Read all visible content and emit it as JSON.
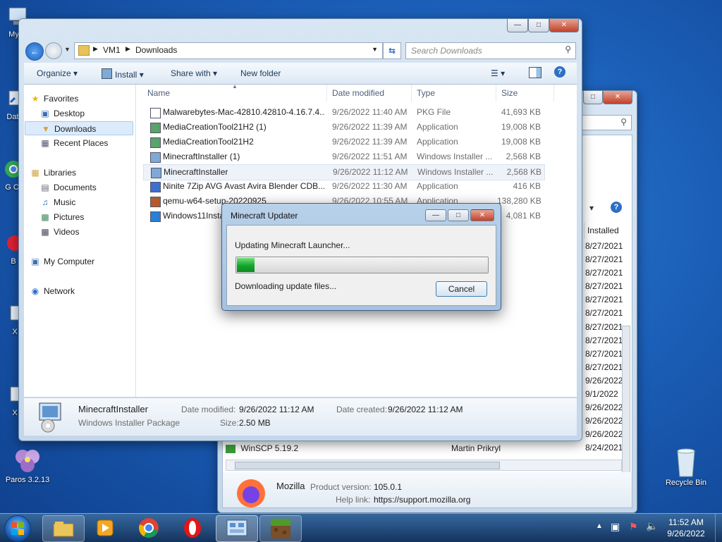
{
  "desktop": {
    "icons": [
      {
        "label": "My C",
        "icon": "computer-icon"
      },
      {
        "label": "Data",
        "icon": "shortcut-icon"
      },
      {
        "label": "G C",
        "icon": "chrome-icon"
      },
      {
        "label": "B",
        "icon": "app-icon"
      },
      {
        "label": "X",
        "icon": "app-icon"
      },
      {
        "label": "X",
        "icon": "app-icon"
      },
      {
        "label": "Paros 3.2.13",
        "icon": "flower-icon"
      },
      {
        "label": "Recycle Bin",
        "icon": "recycle-bin-icon"
      }
    ]
  },
  "explorer": {
    "breadcrumb": [
      "VM1",
      "Downloads"
    ],
    "search_placeholder": "Search Downloads",
    "toolbar": {
      "organize": "Organize",
      "install": "Install",
      "share_with": "Share with",
      "new_folder": "New folder"
    },
    "nav": {
      "favorites": "Favorites",
      "desktop": "Desktop",
      "downloads": "Downloads",
      "recent_places": "Recent Places",
      "libraries": "Libraries",
      "documents": "Documents",
      "music": "Music",
      "pictures": "Pictures",
      "videos": "Videos",
      "my_computer": "My Computer",
      "network": "Network"
    },
    "columns": {
      "name": "Name",
      "date_modified": "Date modified",
      "type": "Type",
      "size": "Size"
    },
    "files": [
      {
        "name": "Malwarebytes-Mac-42810.42810-4.16.7.4...",
        "date": "9/26/2022 11:40 AM",
        "type": "PKG File",
        "size": "41,693 KB"
      },
      {
        "name": "MediaCreationTool21H2 (1)",
        "date": "9/26/2022 11:39 AM",
        "type": "Application",
        "size": "19,008 KB"
      },
      {
        "name": "MediaCreationTool21H2",
        "date": "9/26/2022 11:39 AM",
        "type": "Application",
        "size": "19,008 KB"
      },
      {
        "name": "MinecraftInstaller (1)",
        "date": "9/26/2022 11:51 AM",
        "type": "Windows Installer ...",
        "size": "2,568 KB"
      },
      {
        "name": "MinecraftInstaller",
        "date": "9/26/2022 11:12 AM",
        "type": "Windows Installer ...",
        "size": "2,568 KB"
      },
      {
        "name": "Ninite 7Zip AVG Avast Avira Blender CDB...",
        "date": "9/26/2022 11:30 AM",
        "type": "Application",
        "size": "416 KB"
      },
      {
        "name": "qemu-w64-setup-20220925",
        "date": "9/26/2022 10:55 AM",
        "type": "Application",
        "size": "138,280 KB"
      },
      {
        "name": "Windows11Installer",
        "date": "",
        "type": "",
        "size": "4,081 KB"
      }
    ],
    "details": {
      "name": "MinecraftInstaller",
      "type": "Windows Installer Package",
      "date_modified_label": "Date modified:",
      "date_modified": "9/26/2022 11:12 AM",
      "date_created_label": "Date created:",
      "date_created": "9/26/2022 11:12 AM",
      "size_label": "Size:",
      "size": "2.50 MB"
    }
  },
  "programs_window": {
    "installed_header": "Installed",
    "dates": [
      "8/27/2021",
      "8/27/2021",
      "8/27/2021",
      "8/27/2021",
      "8/27/2021",
      "8/27/2021",
      "8/27/2021",
      "8/27/2021",
      "8/27/2021",
      "8/27/2021",
      "9/26/2022",
      "9/1/2022",
      "9/26/2022",
      "9/26/2022",
      "9/26/2022",
      "8/24/2021"
    ],
    "last_row_name": "WinSCP 5.19.2",
    "last_row_publisher": "Martin Prikryl",
    "selected_name": "Mozilla",
    "product_version_label": "Product version:",
    "product_version": "105.0.1",
    "help_link_label": "Help link:",
    "help_link": "https://support.mozilla.org"
  },
  "updater": {
    "title": "Minecraft Updater",
    "message": "Updating Minecraft Launcher...",
    "progress": 0.07,
    "status": "Downloading update files...",
    "cancel": "Cancel"
  },
  "taskbar": {
    "time": "11:52 AM",
    "date": "9/26/2022",
    "apps": [
      "explorer-icon",
      "media-player-icon",
      "chrome-icon",
      "opera-icon",
      "control-panel-icon",
      "minecraft-icon"
    ]
  }
}
